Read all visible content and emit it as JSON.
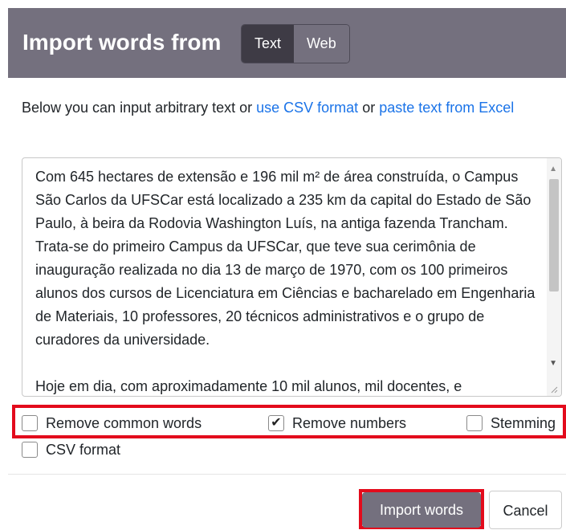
{
  "header": {
    "title": "Import words from",
    "tabs": [
      {
        "label": "Text",
        "active": true
      },
      {
        "label": "Web",
        "active": false
      }
    ]
  },
  "intro": {
    "text_before": "Below you can input arbitrary text or ",
    "link_csv": "use CSV format",
    "text_middle": " or ",
    "link_excel": "paste text from Excel"
  },
  "textarea": {
    "value": "Com 645 hectares de extensão e 196 mil m² de área construída, o Campus São Carlos da UFSCar está localizado a 235 km da capital do Estado de São Paulo, à beira da Rodovia Washington Luís, na antiga fazenda Trancham. Trata-se do primeiro Campus da UFSCar, que teve sua cerimônia de inauguração realizada no dia 13 de março de 1970, com os 100 primeiros alunos dos cursos de Licenciatura em Ciências e bacharelado em Engenharia de Materiais, 10 professores, 20 técnicos administrativos e o grupo de curadores da universidade.\n\nHoje em dia, com aproximadamente 10 mil alunos, mil docentes, e"
  },
  "options": [
    {
      "label": "Remove common words",
      "checked": false
    },
    {
      "label": "Remove numbers",
      "checked": true
    },
    {
      "label": "Stemming",
      "checked": false
    },
    {
      "label": "CSV format",
      "checked": false
    }
  ],
  "buttons": {
    "import_label": "Import words",
    "cancel_label": "Cancel"
  },
  "colors": {
    "header_bg": "#74707e",
    "tab_active_bg": "#3e3b45",
    "link": "#1a73e8",
    "highlight": "#e30b1c"
  }
}
